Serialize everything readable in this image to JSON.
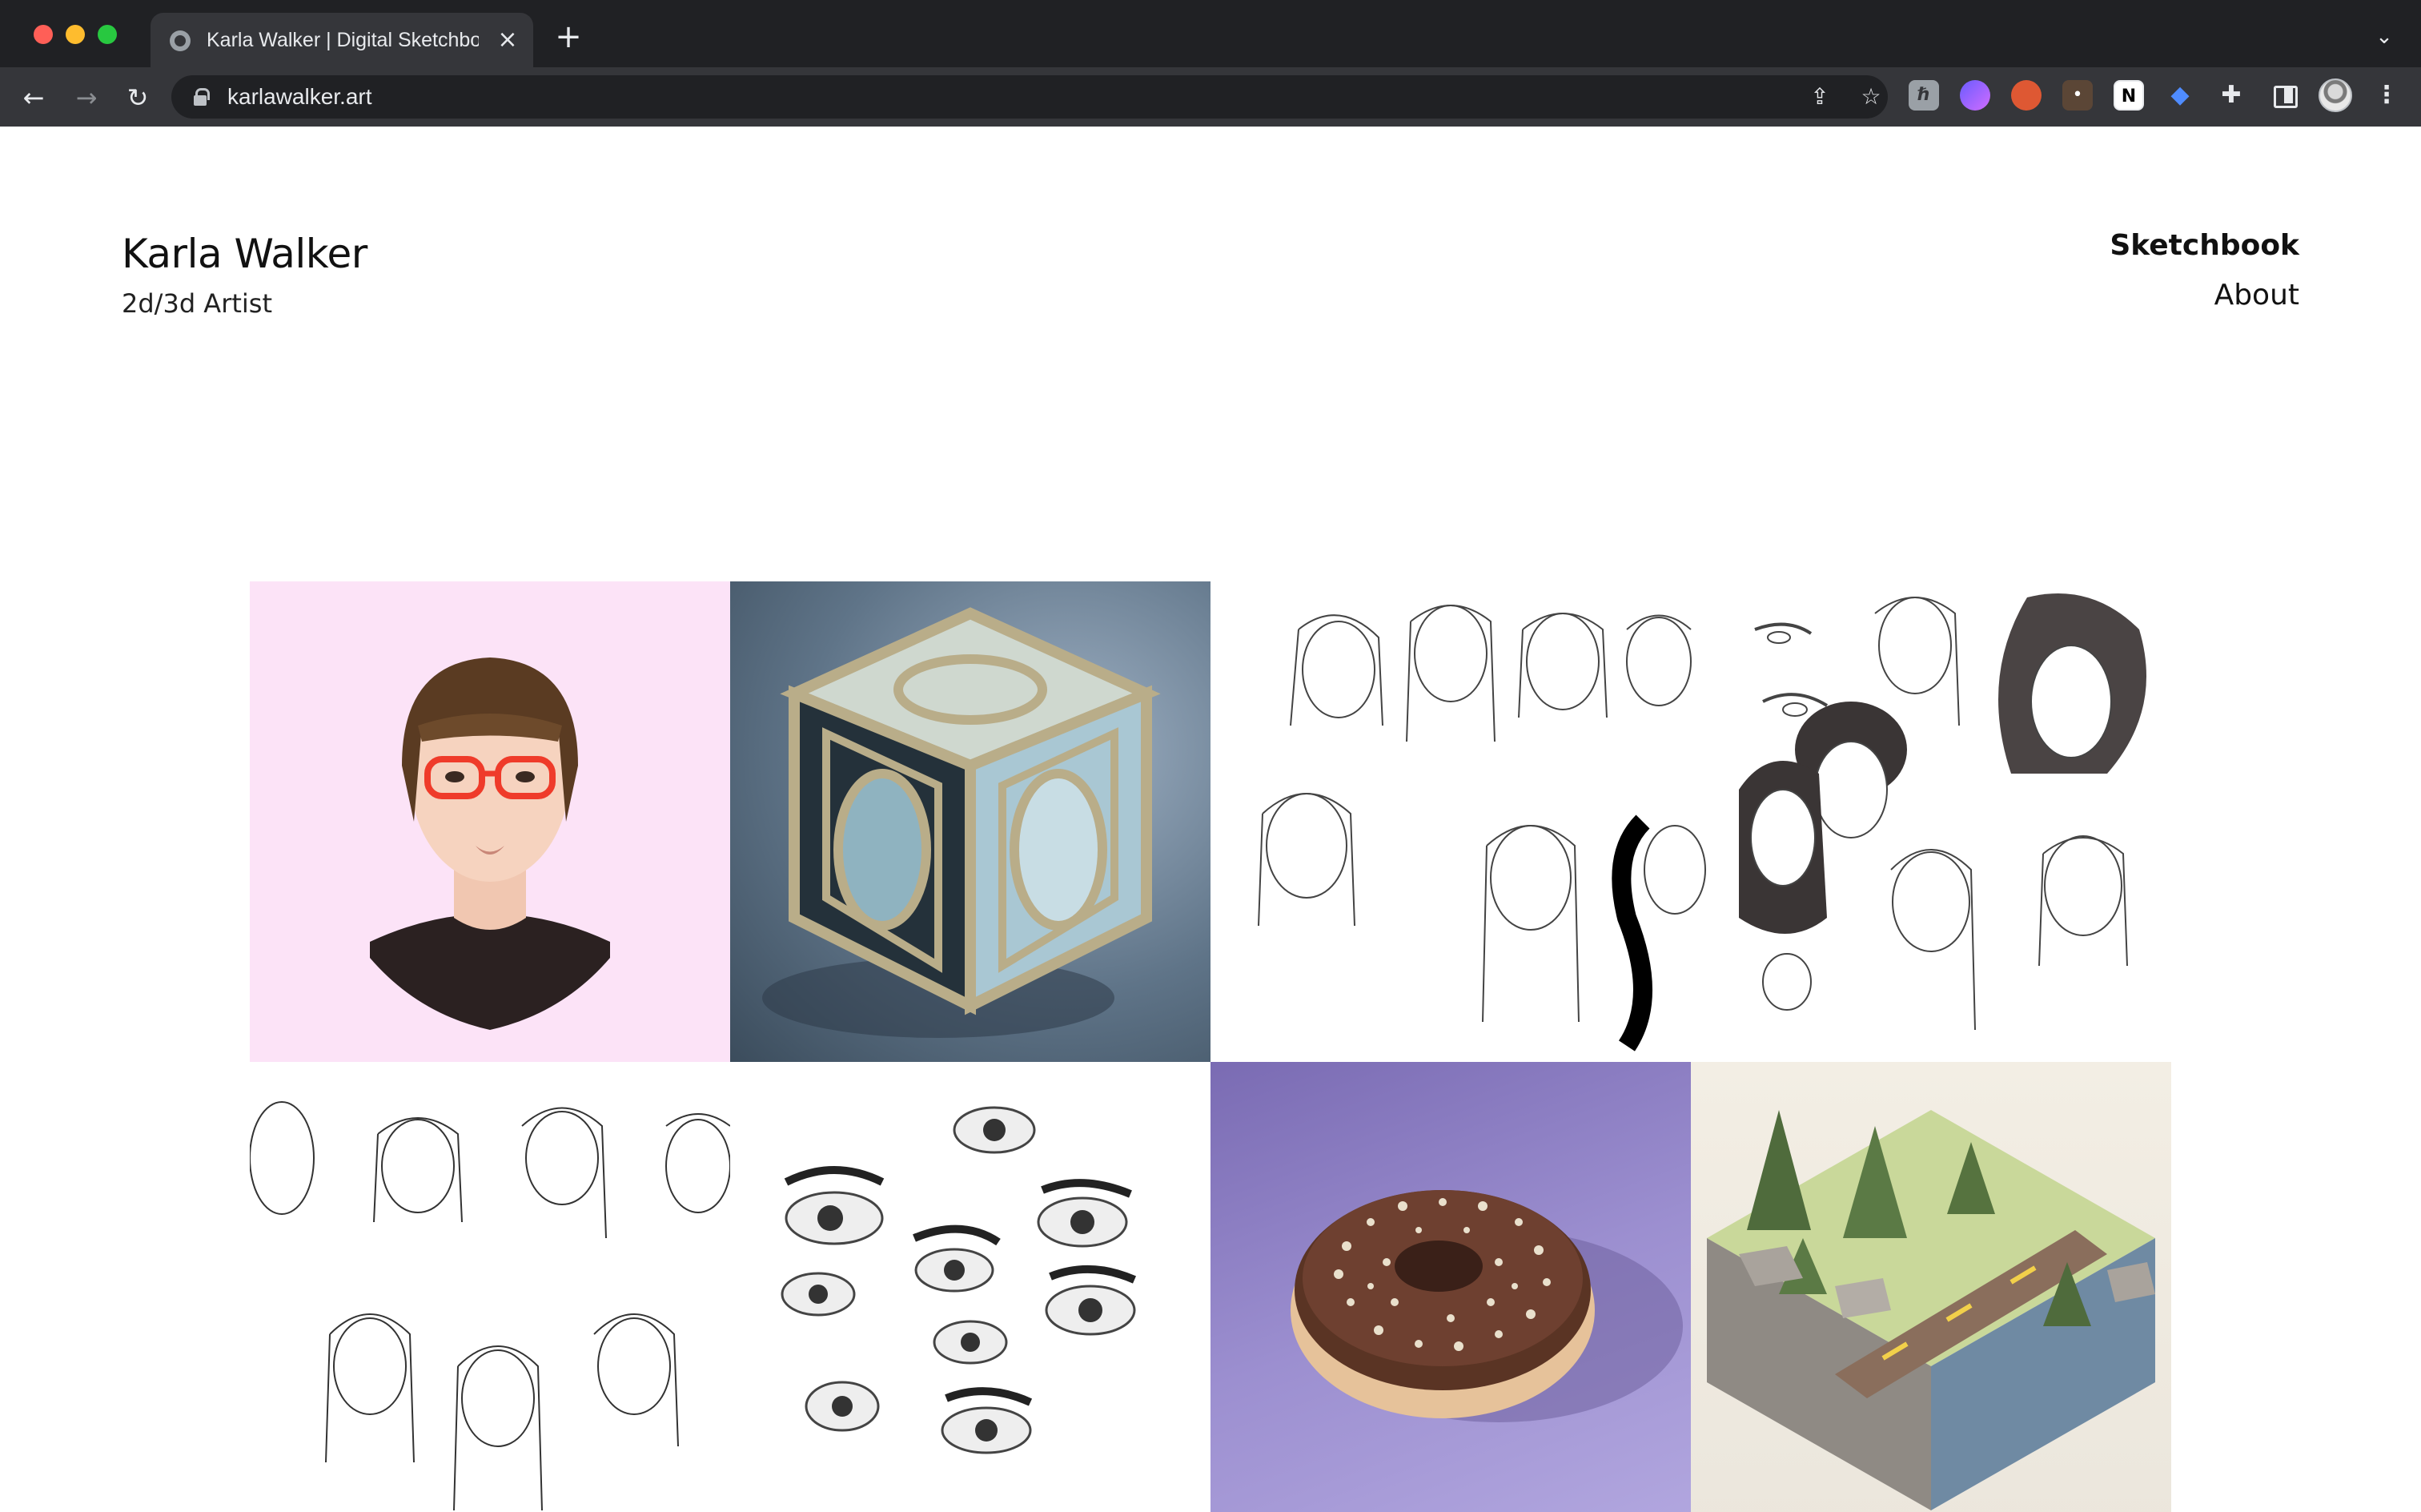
{
  "browser": {
    "tab_title": "Karla Walker | Digital Sketchbook",
    "tab_close": "×",
    "new_tab": "+",
    "url": "karlawalker.art",
    "icons": [
      "globe-icon",
      "close-icon",
      "plus-icon",
      "chevron-down-icon",
      "back-icon",
      "forward-icon",
      "reload-icon",
      "lock-icon",
      "share-icon",
      "star-icon",
      "puzzle-icon",
      "sidebar-icon",
      "profile-avatar",
      "menu-icon"
    ]
  },
  "site": {
    "name": "Karla Walker",
    "tagline": "2d/3d Artist"
  },
  "nav": {
    "items": [
      {
        "label": "Sketchbook",
        "active": true
      },
      {
        "label": "About",
        "active": false
      }
    ]
  },
  "gallery": {
    "tiles": [
      {
        "subject": "portrait-illustration-with-red-glasses"
      },
      {
        "subject": "3d-geometric-cube"
      },
      {
        "subject": "ink-face-sketches-wide"
      },
      {
        "subject": "pencil-portrait-sketches"
      },
      {
        "subject": "eye-studies"
      },
      {
        "subject": "3d-chocolate-donut"
      },
      {
        "subject": "low-poly-forest-diorama"
      }
    ]
  },
  "colors": {
    "chrome_dark": "#202124",
    "toolbar": "#35363a",
    "page_bg": "#ffffff",
    "text": "#111111",
    "portrait_bg": "#fce3f7",
    "donut_bg": "#9c8fd0"
  }
}
